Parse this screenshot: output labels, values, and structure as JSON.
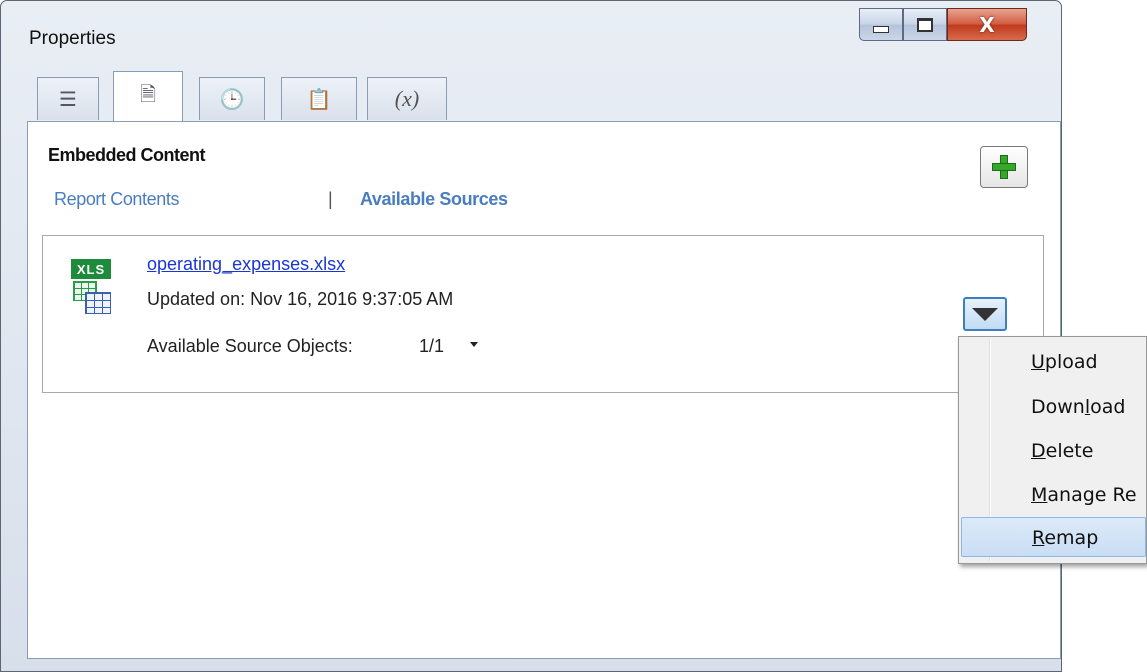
{
  "window": {
    "title": "Properties",
    "minimize_glyph": "minimize",
    "maximize_glyph": "maximize",
    "close_glyph": "X"
  },
  "tabs": [
    {
      "icon": "list-icon",
      "glyph": "☰",
      "active": false
    },
    {
      "icon": "document-icon",
      "glyph": "🗎",
      "active": true
    },
    {
      "icon": "clock-icon",
      "glyph": "🕒",
      "active": false
    },
    {
      "icon": "copy-document-icon",
      "glyph": "📋",
      "active": false
    },
    {
      "icon": "variable-icon",
      "glyph": "(x)",
      "active": false
    }
  ],
  "panel": {
    "section_title": "Embedded Content",
    "nav_report_contents": "Report Contents",
    "nav_separator": "|",
    "nav_available_sources": "Available Sources"
  },
  "source": {
    "icon_label": "XLS",
    "file_name": "operating_expenses.xlsx",
    "updated": "Updated on: Nov 16, 2016 9:37:05 AM",
    "objects_label": "Available Source Objects:",
    "objects_value": "1/1"
  },
  "context_menu": {
    "items": [
      {
        "label": "Upload",
        "underline": "U",
        "highlighted": false
      },
      {
        "label": "Download",
        "underline": "l",
        "highlighted": false
      },
      {
        "label": "Delete",
        "underline": "D",
        "highlighted": false
      },
      {
        "label": "Manage Re",
        "underline": "M",
        "highlighted": false
      },
      {
        "label": "Remap",
        "underline": "R",
        "highlighted": true
      }
    ]
  },
  "colors": {
    "link": "#1a35d6",
    "nav_link": "#4a7dbf",
    "xls_green": "#1e8a3b",
    "add_green": "#35a82a",
    "menu_highlight": "#c9def5"
  }
}
